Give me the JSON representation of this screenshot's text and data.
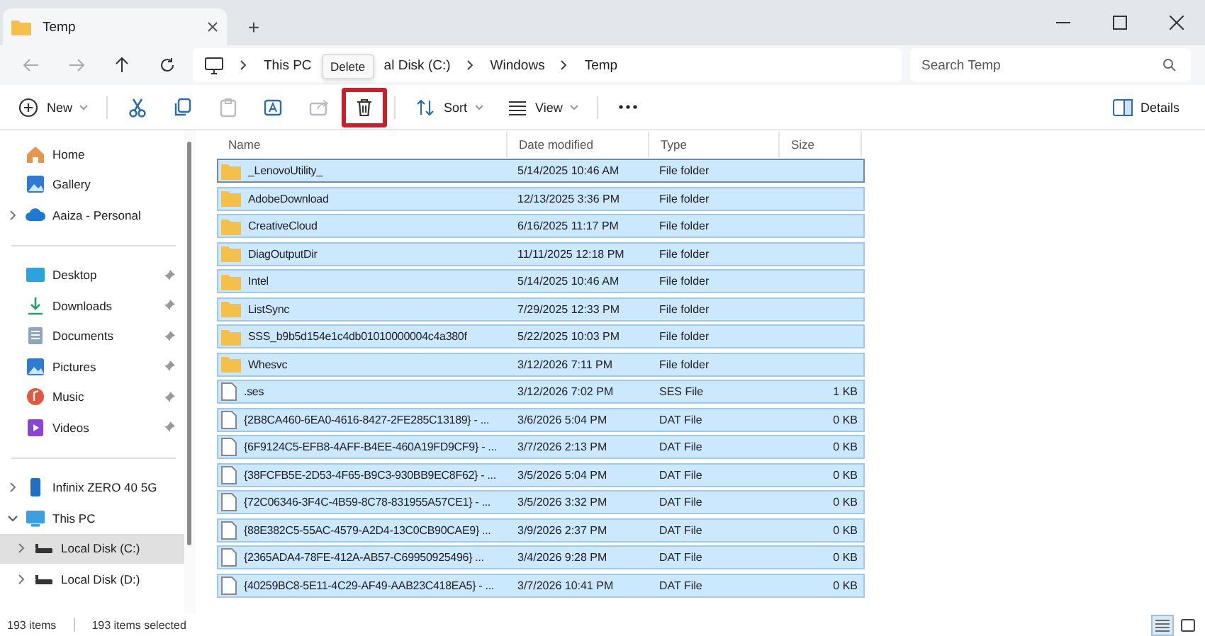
{
  "window": {
    "tab_title": "Temp",
    "new_tab": "+"
  },
  "navigation": {
    "breadcrumb": [
      {
        "label": "This PC",
        "separator": true
      },
      {
        "label": "al Disk (C:)"
      },
      {
        "label": "Windows",
        "separator": true
      },
      {
        "label": "Temp",
        "separator": true
      }
    ],
    "search": {
      "placeholder": "Search Temp"
    }
  },
  "toolbar": {
    "buttons": [
      {
        "kind": "new",
        "label": "New",
        "disabled": false,
        "highlighted": false
      },
      {
        "kind": "cut",
        "disabled": false,
        "highlighted": false
      },
      {
        "kind": "copy",
        "disabled": false,
        "highlighted": false
      },
      {
        "kind": "paste",
        "disabled": true,
        "highlighted": false
      },
      {
        "kind": "rename",
        "disabled": false,
        "highlighted": false
      },
      {
        "kind": "share",
        "disabled": true,
        "highlighted": false
      },
      {
        "kind": "delete",
        "disabled": false,
        "highlighted": true,
        "tooltip": "Delete"
      },
      {
        "kind": "sort",
        "label": "Sort",
        "disabled": false,
        "highlighted": false
      },
      {
        "kind": "view",
        "label": "View",
        "disabled": false,
        "highlighted": false
      },
      {
        "kind": "more",
        "disabled": false,
        "highlighted": false
      }
    ],
    "details": "Details"
  },
  "sidebar": {
    "groups": [
      {
        "items": [
          {
            "kind": "home",
            "label": "Home",
            "selected": false
          },
          {
            "kind": "gallery",
            "label": "Gallery",
            "selected": false
          },
          {
            "kind": "cloud",
            "label": "Aaiza - Personal",
            "selected": false,
            "expanded": false
          }
        ]
      },
      {
        "items": [
          {
            "kind": "desktop",
            "label": "Desktop",
            "selected": false,
            "pinned": true
          },
          {
            "kind": "downloads",
            "label": "Downloads",
            "selected": false,
            "pinned": true
          },
          {
            "kind": "documents",
            "label": "Documents",
            "selected": false,
            "pinned": true
          },
          {
            "kind": "pictures",
            "label": "Pictures",
            "selected": false,
            "pinned": true
          },
          {
            "kind": "music",
            "label": "Music",
            "selected": false,
            "pinned": true
          },
          {
            "kind": "videos",
            "label": "Videos",
            "selected": false,
            "pinned": true
          }
        ]
      },
      {
        "items": [
          {
            "kind": "phone",
            "label": "Infinix ZERO 40 5G",
            "selected": false,
            "expanded": false
          },
          {
            "kind": "pc",
            "label": "This PC",
            "selected": false,
            "expanded": true,
            "children": [
              {
                "kind": "disk",
                "label": "Local Disk (C:)",
                "selected": true,
                "expanded": false
              },
              {
                "kind": "disk",
                "label": "Local Disk (D:)",
                "selected": false,
                "expanded": false
              }
            ]
          }
        ]
      }
    ]
  },
  "table": {
    "columns": [
      "Name",
      "Date modified",
      "Type",
      "Size"
    ],
    "rows": [
      {
        "kind": "folder",
        "selected": true,
        "name": "_LenovoUtility_",
        "date": "5/14/2025 10:46 AM",
        "type": "File folder"
      },
      {
        "kind": "folder",
        "selected": true,
        "name": "AdobeDownload",
        "date": "12/13/2025 3:36 PM",
        "type": "File folder"
      },
      {
        "kind": "folder",
        "selected": true,
        "name": "CreativeCloud",
        "date": "6/16/2025 11:17 PM",
        "type": "File folder"
      },
      {
        "kind": "folder",
        "selected": true,
        "name": "DiagOutputDir",
        "date": "11/11/2025 12:18 PM",
        "type": "File folder"
      },
      {
        "kind": "folder",
        "selected": true,
        "name": "Intel",
        "date": "5/14/2025 10:46 AM",
        "type": "File folder"
      },
      {
        "kind": "folder",
        "selected": true,
        "name": "ListSync",
        "date": "7/29/2025 12:33 PM",
        "type": "File folder"
      },
      {
        "kind": "folder",
        "selected": true,
        "name": "SSS_b9b5d154e1c4db01010000004c4a380f",
        "date": "5/22/2025 10:03 PM",
        "type": "File folder"
      },
      {
        "kind": "folder",
        "selected": true,
        "name": "Whesvc",
        "date": "3/12/2026 7:11 PM",
        "type": "File folder"
      },
      {
        "kind": "file",
        "selected": true,
        "name": ".ses",
        "date": "3/12/2026 7:02 PM",
        "type": "SES File",
        "size": "1 KB"
      },
      {
        "kind": "file",
        "selected": true,
        "name": "{2B8CA460-6EA0-4616-8427-2FE285C13189} - ...",
        "date": "3/6/2026 5:04 PM",
        "type": "DAT File",
        "size": "0 KB"
      },
      {
        "kind": "file",
        "selected": true,
        "name": "{6F9124C5-EFB8-4AFF-B4EE-460A19FD9CF9} - ...",
        "date": "3/7/2026 2:13 PM",
        "type": "DAT File",
        "size": "0 KB"
      },
      {
        "kind": "file",
        "selected": true,
        "name": "{38FCFB5E-2D53-4F65-B9C3-930BB9EC8F62} - ...",
        "date": "3/5/2026 5:04 PM",
        "type": "DAT File",
        "size": "0 KB"
      },
      {
        "kind": "file",
        "selected": true,
        "name": "{72C06346-3F4C-4B59-8C78-831955A57CE1} - ...",
        "date": "3/5/2026 3:32 PM",
        "type": "DAT File",
        "size": "0 KB"
      },
      {
        "kind": "file",
        "selected": true,
        "name": "{88E382C5-55AC-4579-A2D4-13C0CB90CAE9} ...",
        "date": "3/9/2026 2:37 PM",
        "type": "DAT File",
        "size": "0 KB"
      },
      {
        "kind": "file",
        "selected": true,
        "name": "{2365ADA4-78FE-412A-AB57-C69950925496} ...",
        "date": "3/4/2026 9:28 PM",
        "type": "DAT File",
        "size": "0 KB"
      },
      {
        "kind": "file",
        "selected": true,
        "name": "{40259BC8-5E11-4C29-AF49-AAB23C418EA5} - ...",
        "date": "3/7/2026 10:41 PM",
        "type": "DAT File",
        "size": "0 KB"
      }
    ]
  },
  "status_bar": {
    "count": "193 items",
    "selection": "193 items selected",
    "views": [
      {
        "kind": "details",
        "selected": true
      },
      {
        "kind": "tiles",
        "selected": false
      }
    ]
  }
}
